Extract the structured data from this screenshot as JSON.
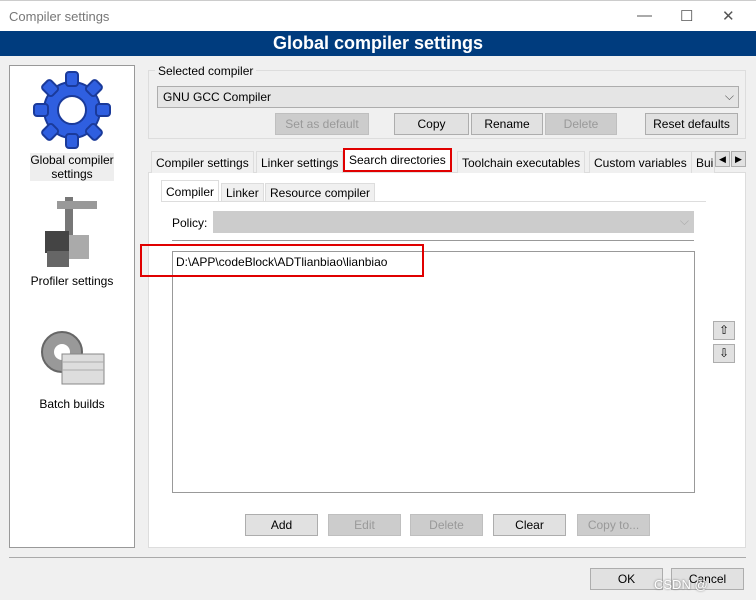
{
  "window": {
    "title": "Compiler settings",
    "banner": "Global compiler settings"
  },
  "sidebar": {
    "items": [
      {
        "label": "Global compiler settings"
      },
      {
        "label": "Profiler settings"
      },
      {
        "label": "Batch builds"
      }
    ]
  },
  "compiler_group": {
    "legend": "Selected compiler",
    "selected": "GNU GCC Compiler",
    "buttons": {
      "set_default": "Set as default",
      "copy": "Copy",
      "rename": "Rename",
      "delete": "Delete",
      "reset": "Reset defaults"
    }
  },
  "tabs": [
    "Compiler settings",
    "Linker settings",
    "Search directories",
    "Toolchain executables",
    "Custom variables",
    "Bui"
  ],
  "subtabs": [
    "Compiler",
    "Linker",
    "Resource compiler"
  ],
  "policy": {
    "label": "Policy:",
    "value": ""
  },
  "directories": [
    "D:\\APP\\codeBlock\\ADTlianbiao\\lianbiao"
  ],
  "list_buttons": {
    "add": "Add",
    "edit": "Edit",
    "delete": "Delete",
    "clear": "Clear",
    "copy_to": "Copy to..."
  },
  "dialog": {
    "ok": "OK",
    "cancel": "Cancel"
  },
  "watermark": "CSDN @"
}
